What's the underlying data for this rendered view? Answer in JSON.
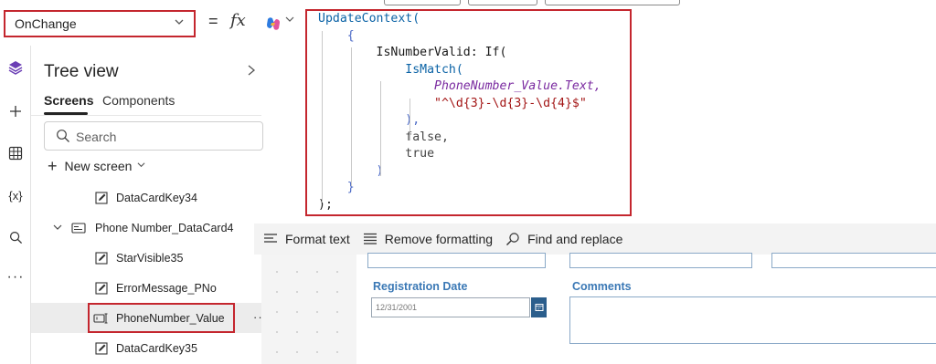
{
  "formula_bar": {
    "property": "OnChange",
    "equals": "=",
    "fx": "fx"
  },
  "formula": {
    "lines": [
      "UpdateContext(",
      "    {",
      "        IsNumberValid: If(",
      "            IsMatch(",
      "                PhoneNumber_Value.Text,",
      "                \"^\\d{3}-\\d{3}-\\d{4}$\"",
      "            ),",
      "            false,",
      "            true",
      "        )",
      "    }",
      ");"
    ]
  },
  "left_rail": {
    "icons": [
      "layers-icon",
      "plus-icon",
      "table-icon",
      "variables-icon",
      "search-icon",
      "more-icon"
    ],
    "variables_glyph": "{x}"
  },
  "tree": {
    "title": "Tree view",
    "tabs": {
      "screens": "Screens",
      "components": "Components"
    },
    "search_placeholder": "Search",
    "new_screen": "New screen",
    "items": [
      {
        "label": "DataCardKey34",
        "type": "edit"
      },
      {
        "label": "Phone Number_DataCard4",
        "type": "card"
      },
      {
        "label": "StarVisible35",
        "type": "edit"
      },
      {
        "label": "ErrorMessage_PNo",
        "type": "edit"
      },
      {
        "label": "PhoneNumber_Value",
        "type": "input",
        "selected": true
      },
      {
        "label": "DataCardKey35",
        "type": "edit"
      }
    ]
  },
  "format_toolbar": {
    "format_text": "Format text",
    "remove_formatting": "Remove formatting",
    "find_replace": "Find and replace"
  },
  "form": {
    "registration_label": "Registration Date",
    "registration_value": "12/31/2001",
    "comments_label": "Comments"
  },
  "colors": {
    "highlight_border": "#c4262e",
    "form_label": "#3a78b5",
    "date_button": "#2b5e8c"
  }
}
